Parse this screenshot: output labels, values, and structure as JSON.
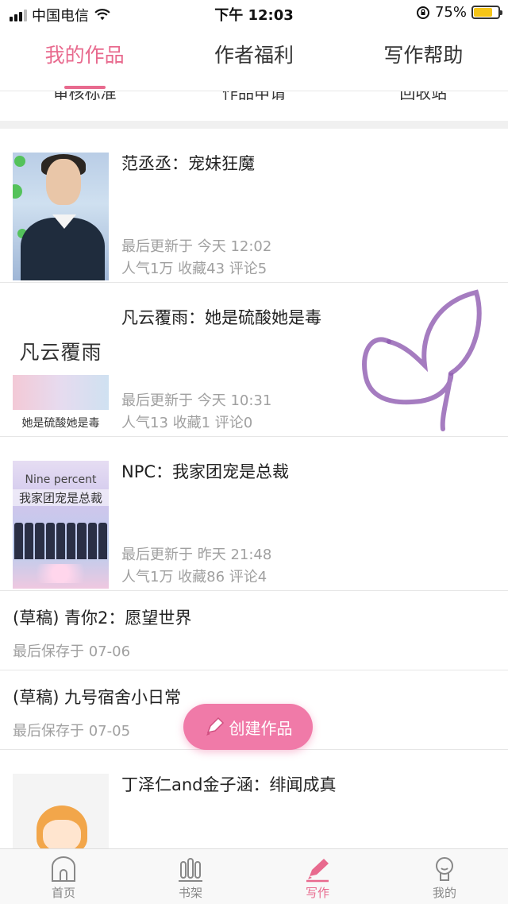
{
  "status_bar": {
    "carrier": "中国电信",
    "time": "下午 12:03",
    "battery": "75%",
    "battery_level": 0.75
  },
  "top_tabs": [
    {
      "label": "我的作品",
      "active": true
    },
    {
      "label": "作者福利",
      "active": false
    },
    {
      "label": "写作帮助",
      "active": false
    }
  ],
  "sub_menu": [
    "审核标准",
    "作品申请",
    "回收站"
  ],
  "works": [
    {
      "title": "范丞丞：宠妹狂魔",
      "updated": "最后更新于 今天 12:02",
      "stats": "人气1万 收藏43 评论5"
    },
    {
      "title": "凡云覆雨：她是硫酸她是毒",
      "updated": "最后更新于 今天 10:31",
      "stats": "人气13 收藏1 评论0",
      "cover_text": {
        "title": "凡云覆雨",
        "subtitle": "她是硫酸她是毒"
      }
    },
    {
      "title": "NPC：我家团宠是总裁",
      "updated": "最后更新于 昨天 21:48",
      "stats": "人气1万 收藏86 评论4",
      "cover_text": {
        "en": "Nine percent",
        "cn": "我家团宠是总裁"
      }
    },
    {
      "title": "丁泽仁and金子涵：绯闻成真"
    }
  ],
  "drafts": [
    {
      "title": "(草稿) 青你2：愿望世界",
      "saved": "最后保存于 07-06"
    },
    {
      "title": "(草稿) 九号宿舍小日常",
      "saved": "最后保存于 07-05"
    }
  ],
  "create_button": {
    "label": "创建作品",
    "icon": "pencil-icon"
  },
  "bottom_nav": [
    {
      "label": "首页",
      "icon": "home-icon",
      "active": false
    },
    {
      "label": "书架",
      "icon": "bookshelf-icon",
      "active": false
    },
    {
      "label": "写作",
      "icon": "pencil-icon",
      "active": true
    },
    {
      "label": "我的",
      "icon": "profile-icon",
      "active": false
    }
  ],
  "colors": {
    "accent": "#e86a8e",
    "button": "#f07aa8",
    "scribble": "#8e5bb0"
  }
}
